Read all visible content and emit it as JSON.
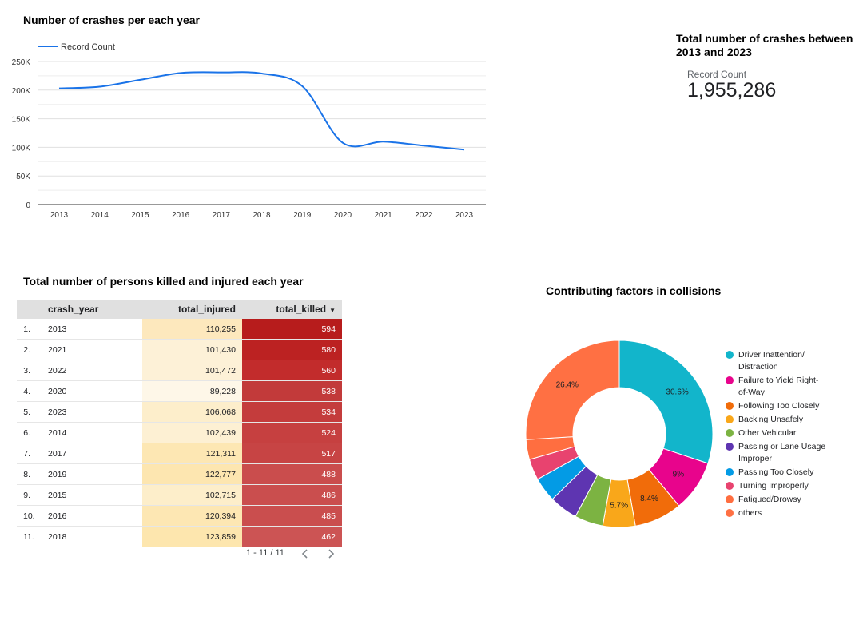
{
  "line_title": "Number of crashes per each year",
  "scorecard": {
    "title": "Total number of crashes between 2013 and 2023",
    "label": "Record Count",
    "value": "1,955,286"
  },
  "table": {
    "title": "Total number of persons killed and injured each year",
    "columns": [
      "crash_year",
      "total_injured",
      "total_killed"
    ],
    "rows": [
      {
        "idx": "1.",
        "year": "2013",
        "injured": "110,255",
        "killed": "594",
        "injured_color": "#fde8bd",
        "killed_color": "#b71c1c"
      },
      {
        "idx": "2.",
        "year": "2021",
        "injured": "101,430",
        "killed": "580",
        "injured_color": "#fdf1d7",
        "killed_color": "#bc2222"
      },
      {
        "idx": "3.",
        "year": "2022",
        "injured": "101,472",
        "killed": "560",
        "injured_color": "#fdf1d7",
        "killed_color": "#c22c2c"
      },
      {
        "idx": "4.",
        "year": "2020",
        "injured": "89,228",
        "killed": "538",
        "injured_color": "#fef7e8",
        "killed_color": "#c23a3a"
      },
      {
        "idx": "5.",
        "year": "2023",
        "injured": "106,068",
        "killed": "534",
        "injured_color": "#fdeecb",
        "killed_color": "#c43c3c"
      },
      {
        "idx": "6.",
        "year": "2014",
        "injured": "102,439",
        "killed": "524",
        "injured_color": "#fdf0d3",
        "killed_color": "#c64040"
      },
      {
        "idx": "7.",
        "year": "2017",
        "injured": "121,311",
        "killed": "517",
        "injured_color": "#fde7b3",
        "killed_color": "#c74444"
      },
      {
        "idx": "8.",
        "year": "2019",
        "injured": "122,777",
        "killed": "488",
        "injured_color": "#fde6b0",
        "killed_color": "#ca4d4d"
      },
      {
        "idx": "9.",
        "year": "2015",
        "injured": "102,715",
        "killed": "486",
        "injured_color": "#fdeeca",
        "killed_color": "#ca4e4e"
      },
      {
        "idx": "10.",
        "year": "2016",
        "injured": "120,394",
        "killed": "485",
        "injured_color": "#fde7b3",
        "killed_color": "#ca4e4e"
      },
      {
        "idx": "11.",
        "year": "2018",
        "injured": "123,859",
        "killed": "462",
        "injured_color": "#fde6ae",
        "killed_color": "#cc5454"
      }
    ],
    "pagination": "1 - 11 / 11"
  },
  "pie_title": "Contributing factors in collisions",
  "chart_data": [
    {
      "type": "line",
      "legend": "Record Count",
      "x": [
        "2013",
        "2014",
        "2015",
        "2016",
        "2017",
        "2018",
        "2019",
        "2020",
        "2021",
        "2022",
        "2023"
      ],
      "series": [
        {
          "name": "Record Count",
          "values": [
            203000,
            206000,
            218000,
            230000,
            231000,
            229000,
            207000,
            108000,
            110000,
            103000,
            96000
          ]
        }
      ],
      "yticks": [
        "0",
        "50K",
        "100K",
        "150K",
        "200K",
        "250K"
      ],
      "ylim": [
        0,
        250000
      ],
      "color": "#1a73e8",
      "grid": true,
      "legend_position": "top-left"
    },
    {
      "type": "pie",
      "donut": true,
      "labels": [
        "Driver Inattention/ Distraction",
        "Failure to Yield Right-of-Way",
        "Following Too Closely",
        "Backing Unsafely",
        "Other Vehicular",
        "Passing or Lane Usage Improper",
        "Passing Too Closely",
        "Turning Improperly",
        "Fatigued/Drowsy",
        "others"
      ],
      "legend_lines": [
        [
          "Driver Inattention/",
          "Distraction"
        ],
        [
          "Failure to Yield Right-",
          "of-Way"
        ],
        [
          "Following Too Closely"
        ],
        [
          "Backing Unsafely"
        ],
        [
          "Other Vehicular"
        ],
        [
          "Passing or Lane Usage",
          "Improper"
        ],
        [
          "Passing Too Closely"
        ],
        [
          "Turning Improperly"
        ],
        [
          "Fatigued/Drowsy"
        ],
        [
          "others"
        ]
      ],
      "values": [
        30.6,
        9.0,
        8.4,
        5.7,
        5.0,
        5.0,
        4.3,
        3.7,
        3.5,
        26.4
      ],
      "value_labels": [
        "30.6%",
        "9%",
        "8.4%",
        "5.7%",
        "",
        "",
        "",
        "",
        "",
        "26.4%"
      ],
      "colors": [
        "#12b5cb",
        "#e8048c",
        "#f16c0a",
        "#f9a71a",
        "#7cb342",
        "#5e35b1",
        "#039be5",
        "#e8436f",
        "#ff6e40",
        "#ff7043"
      ],
      "legend_position": "right"
    }
  ]
}
